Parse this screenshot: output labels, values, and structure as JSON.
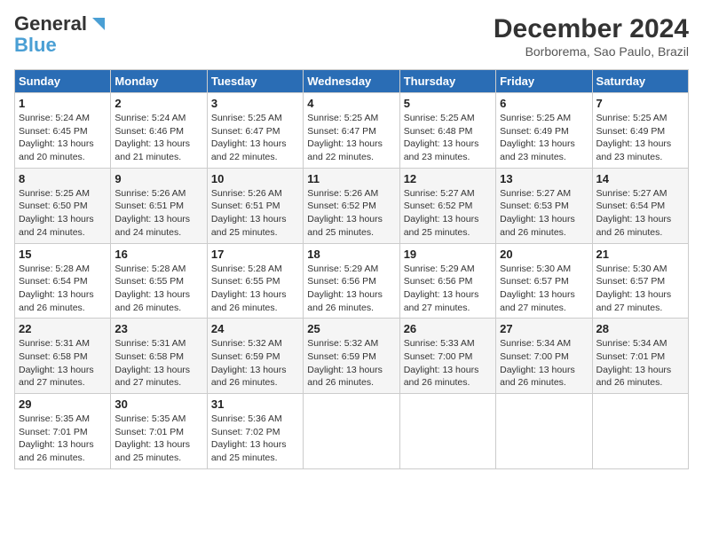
{
  "logo": {
    "part1": "General",
    "part2": "Blue"
  },
  "title": "December 2024",
  "subtitle": "Borborema, Sao Paulo, Brazil",
  "days_of_week": [
    "Sunday",
    "Monday",
    "Tuesday",
    "Wednesday",
    "Thursday",
    "Friday",
    "Saturday"
  ],
  "weeks": [
    [
      {
        "day": "1",
        "info": "Sunrise: 5:24 AM\nSunset: 6:45 PM\nDaylight: 13 hours\nand 20 minutes."
      },
      {
        "day": "2",
        "info": "Sunrise: 5:24 AM\nSunset: 6:46 PM\nDaylight: 13 hours\nand 21 minutes."
      },
      {
        "day": "3",
        "info": "Sunrise: 5:25 AM\nSunset: 6:47 PM\nDaylight: 13 hours\nand 22 minutes."
      },
      {
        "day": "4",
        "info": "Sunrise: 5:25 AM\nSunset: 6:47 PM\nDaylight: 13 hours\nand 22 minutes."
      },
      {
        "day": "5",
        "info": "Sunrise: 5:25 AM\nSunset: 6:48 PM\nDaylight: 13 hours\nand 23 minutes."
      },
      {
        "day": "6",
        "info": "Sunrise: 5:25 AM\nSunset: 6:49 PM\nDaylight: 13 hours\nand 23 minutes."
      },
      {
        "day": "7",
        "info": "Sunrise: 5:25 AM\nSunset: 6:49 PM\nDaylight: 13 hours\nand 23 minutes."
      }
    ],
    [
      {
        "day": "8",
        "info": "Sunrise: 5:25 AM\nSunset: 6:50 PM\nDaylight: 13 hours\nand 24 minutes."
      },
      {
        "day": "9",
        "info": "Sunrise: 5:26 AM\nSunset: 6:51 PM\nDaylight: 13 hours\nand 24 minutes."
      },
      {
        "day": "10",
        "info": "Sunrise: 5:26 AM\nSunset: 6:51 PM\nDaylight: 13 hours\nand 25 minutes."
      },
      {
        "day": "11",
        "info": "Sunrise: 5:26 AM\nSunset: 6:52 PM\nDaylight: 13 hours\nand 25 minutes."
      },
      {
        "day": "12",
        "info": "Sunrise: 5:27 AM\nSunset: 6:52 PM\nDaylight: 13 hours\nand 25 minutes."
      },
      {
        "day": "13",
        "info": "Sunrise: 5:27 AM\nSunset: 6:53 PM\nDaylight: 13 hours\nand 26 minutes."
      },
      {
        "day": "14",
        "info": "Sunrise: 5:27 AM\nSunset: 6:54 PM\nDaylight: 13 hours\nand 26 minutes."
      }
    ],
    [
      {
        "day": "15",
        "info": "Sunrise: 5:28 AM\nSunset: 6:54 PM\nDaylight: 13 hours\nand 26 minutes."
      },
      {
        "day": "16",
        "info": "Sunrise: 5:28 AM\nSunset: 6:55 PM\nDaylight: 13 hours\nand 26 minutes."
      },
      {
        "day": "17",
        "info": "Sunrise: 5:28 AM\nSunset: 6:55 PM\nDaylight: 13 hours\nand 26 minutes."
      },
      {
        "day": "18",
        "info": "Sunrise: 5:29 AM\nSunset: 6:56 PM\nDaylight: 13 hours\nand 26 minutes."
      },
      {
        "day": "19",
        "info": "Sunrise: 5:29 AM\nSunset: 6:56 PM\nDaylight: 13 hours\nand 27 minutes."
      },
      {
        "day": "20",
        "info": "Sunrise: 5:30 AM\nSunset: 6:57 PM\nDaylight: 13 hours\nand 27 minutes."
      },
      {
        "day": "21",
        "info": "Sunrise: 5:30 AM\nSunset: 6:57 PM\nDaylight: 13 hours\nand 27 minutes."
      }
    ],
    [
      {
        "day": "22",
        "info": "Sunrise: 5:31 AM\nSunset: 6:58 PM\nDaylight: 13 hours\nand 27 minutes."
      },
      {
        "day": "23",
        "info": "Sunrise: 5:31 AM\nSunset: 6:58 PM\nDaylight: 13 hours\nand 27 minutes."
      },
      {
        "day": "24",
        "info": "Sunrise: 5:32 AM\nSunset: 6:59 PM\nDaylight: 13 hours\nand 26 minutes."
      },
      {
        "day": "25",
        "info": "Sunrise: 5:32 AM\nSunset: 6:59 PM\nDaylight: 13 hours\nand 26 minutes."
      },
      {
        "day": "26",
        "info": "Sunrise: 5:33 AM\nSunset: 7:00 PM\nDaylight: 13 hours\nand 26 minutes."
      },
      {
        "day": "27",
        "info": "Sunrise: 5:34 AM\nSunset: 7:00 PM\nDaylight: 13 hours\nand 26 minutes."
      },
      {
        "day": "28",
        "info": "Sunrise: 5:34 AM\nSunset: 7:01 PM\nDaylight: 13 hours\nand 26 minutes."
      }
    ],
    [
      {
        "day": "29",
        "info": "Sunrise: 5:35 AM\nSunset: 7:01 PM\nDaylight: 13 hours\nand 26 minutes."
      },
      {
        "day": "30",
        "info": "Sunrise: 5:35 AM\nSunset: 7:01 PM\nDaylight: 13 hours\nand 25 minutes."
      },
      {
        "day": "31",
        "info": "Sunrise: 5:36 AM\nSunset: 7:02 PM\nDaylight: 13 hours\nand 25 minutes."
      },
      {
        "day": "",
        "info": ""
      },
      {
        "day": "",
        "info": ""
      },
      {
        "day": "",
        "info": ""
      },
      {
        "day": "",
        "info": ""
      }
    ]
  ]
}
